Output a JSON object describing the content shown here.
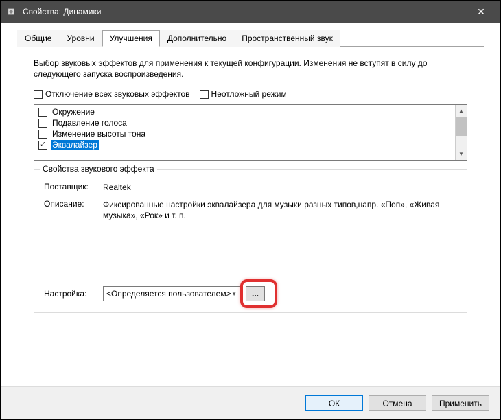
{
  "title": "Свойства: Динамики",
  "tabs": [
    "Общие",
    "Уровни",
    "Улучшения",
    "Дополнительно",
    "Пространственный звук"
  ],
  "activeTab": 2,
  "description": "Выбор звуковых эффектов для применения к текущей конфигурации. Изменения не вступят в силу до следующего запуска воспроизведения.",
  "disableAllEffects": {
    "label": "Отключение всех звуковых эффектов",
    "checked": false
  },
  "urgentMode": {
    "label": "Неотложный режим",
    "checked": false
  },
  "effects": [
    {
      "label": "Окружение",
      "checked": false,
      "selected": false
    },
    {
      "label": "Подавление голоса",
      "checked": false,
      "selected": false
    },
    {
      "label": "Изменение высоты тона",
      "checked": false,
      "selected": false
    },
    {
      "label": "Эквалайзер",
      "checked": true,
      "selected": true
    }
  ],
  "groupbox": {
    "title": "Свойства звукового эффекта",
    "providerLabel": "Поставщик:",
    "providerValue": "Realtek",
    "descLabel": "Описание:",
    "descValue": "Фиксированные настройки эквалайзера для музыки разных типов,напр. «Поп», «Живая музыка», «Рок» и т. п.",
    "settingLabel": "Настройка:",
    "settingValue": "<Определяется пользователем>",
    "moreBtn": "..."
  },
  "buttons": {
    "ok": "ОК",
    "cancel": "Отмена",
    "apply": "Применить"
  }
}
